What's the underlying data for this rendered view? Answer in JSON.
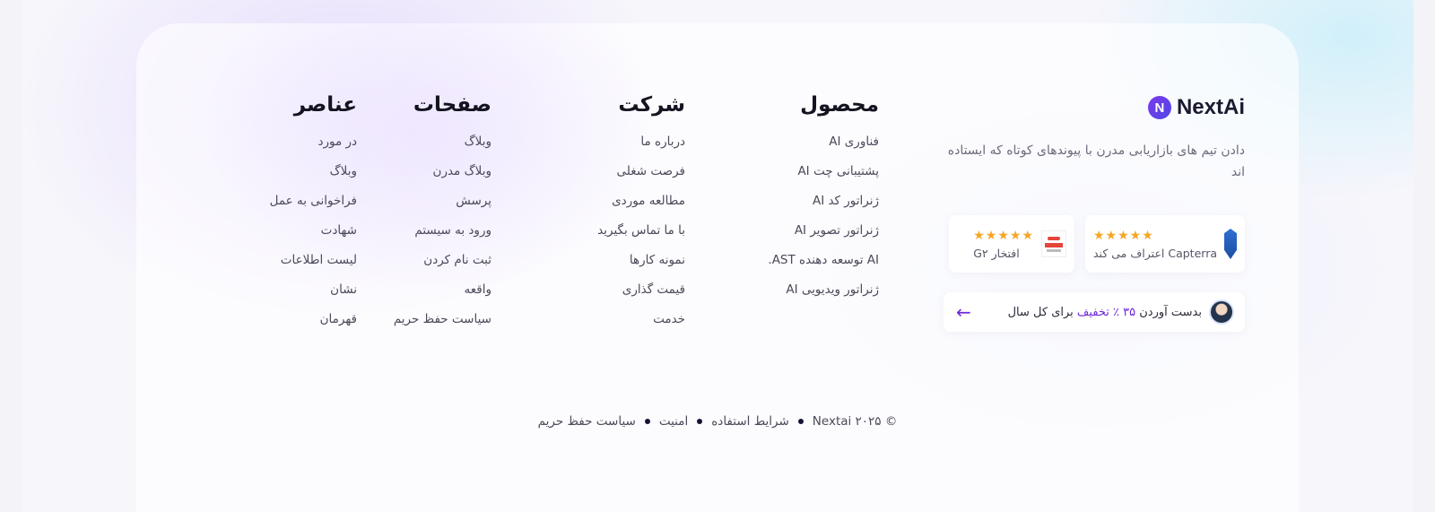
{
  "brand": {
    "logo_text": "NextAi",
    "logo_letter": "N",
    "description": "دادن تیم های بازاریابی مدرن با پیوندهای کوتاه که ایستاده اند"
  },
  "badges": {
    "capterra": {
      "stars": "★★★★★",
      "text": "Capterra اعتراف می کند"
    },
    "g2": {
      "stars": "★★★★★",
      "text": "افتخار G۲"
    }
  },
  "promo": {
    "prefix": "بدست آوردن",
    "highlight": "۳۵ ٪ تخفیف",
    "suffix": "برای کل سال",
    "arrow": "←"
  },
  "columns": {
    "product": {
      "title": "محصول",
      "items": [
        "فناوری AI",
        "پشتیبانی چت AI",
        "ژنراتور کد AI",
        "ژنراتور تصویر AI",
        "AI توسعه دهنده AST.",
        "ژنراتور ویدیویی AI"
      ]
    },
    "company": {
      "title": "شرکت",
      "items": [
        "درباره ما",
        "فرصت شغلی",
        "مطالعه موردی",
        "با ما تماس بگیرید",
        "نمونه کارها",
        "قیمت گذاری",
        "خدمت"
      ]
    },
    "pages": {
      "title": "صفحات",
      "items": [
        "وبلاگ",
        "وبلاگ مدرن",
        "پرسش",
        "ورود به سیستم",
        "ثبت نام کردن",
        "واقعه",
        "سیاست حفظ حریم"
      ]
    },
    "elements": {
      "title": "عناصر",
      "items": [
        "در مورد",
        "وبلاگ",
        "فراخوانی به عمل",
        "شهادت",
        "لیست اطلاعات",
        "نشان",
        "قهرمان"
      ]
    }
  },
  "bottom": {
    "copyright": "© Nextai ۲۰۲۵",
    "terms": "شرایط استفاده",
    "security": "امنیت",
    "privacy": "سیاست حفظ حریم"
  },
  "colors": {
    "accent": "#6d28d9",
    "star": "#f5a623",
    "heading": "#141420",
    "link": "#4a4a5a"
  }
}
